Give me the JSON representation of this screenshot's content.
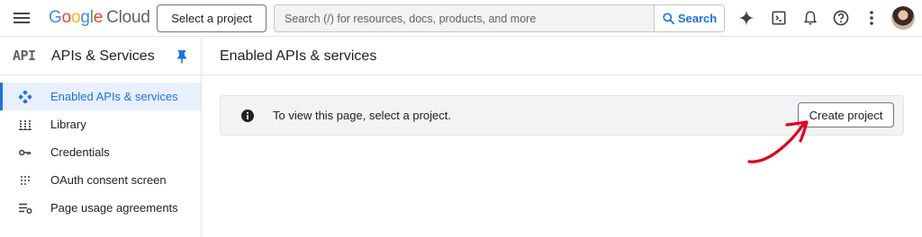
{
  "topbar": {
    "logo_google": "Google",
    "logo_cloud": "Cloud",
    "select_project_label": "Select a project",
    "search_placeholder": "Search (/) for resources, docs, products, and more",
    "search_button_label": "Search"
  },
  "sidebar": {
    "api_mark": "API",
    "title": "APIs & Services",
    "items": [
      {
        "label": "Enabled APIs & services",
        "icon": "apis-diamond-icon",
        "active": true
      },
      {
        "label": "Library",
        "icon": "library-icon",
        "active": false
      },
      {
        "label": "Credentials",
        "icon": "key-icon",
        "active": false
      },
      {
        "label": "OAuth consent screen",
        "icon": "oauth-icon",
        "active": false
      },
      {
        "label": "Page usage agreements",
        "icon": "settings-list-icon",
        "active": false
      }
    ]
  },
  "main": {
    "title": "Enabled APIs & services",
    "banner_text": "To view this page, select a project.",
    "create_button_label": "Create project"
  },
  "colors": {
    "accent": "#1a73e8",
    "active_bg": "#e8f0fe",
    "annotation": "#e0001b"
  }
}
